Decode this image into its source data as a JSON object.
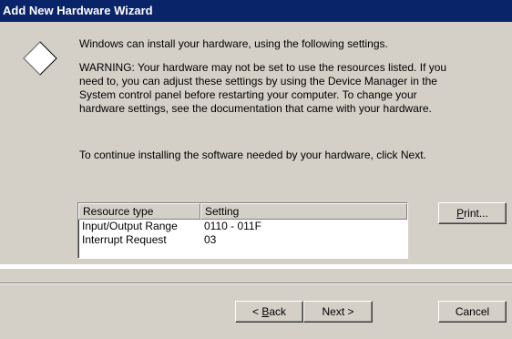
{
  "window": {
    "title": "Add New Hardware Wizard"
  },
  "icon": "diamond-outline-icon",
  "body": {
    "intro": "Windows can install your hardware, using the following settings.",
    "warning_lines": [
      "WARNING:  Your hardware may not be set to use the resources listed. If you",
      "need to, you can adjust these settings by using the Device Manager in the",
      "System control panel before restarting your computer. To change your",
      "hardware settings, see the documentation that came with your hardware."
    ],
    "continue": "To continue installing the software needed by your hardware, click Next."
  },
  "resources": {
    "columns": [
      "Resource type",
      "Setting"
    ],
    "rows": [
      [
        "Input/Output Range",
        "0110 - 011F"
      ],
      [
        "Interrupt Request",
        "03"
      ]
    ]
  },
  "buttons": {
    "print": {
      "mnemonic": "P",
      "rest": "rint..."
    },
    "back": {
      "prefix": "< ",
      "mnemonic": "B",
      "rest": "ack"
    },
    "next": "Next >",
    "cancel": "Cancel"
  }
}
